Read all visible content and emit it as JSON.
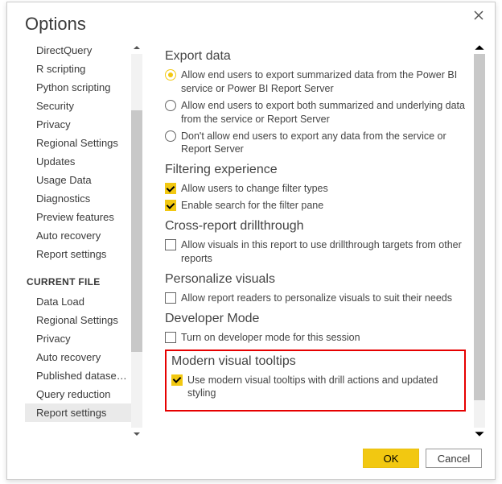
{
  "dialog": {
    "title": "Options",
    "ok": "OK",
    "cancel": "Cancel"
  },
  "nav": {
    "global": {
      "items": [
        "DirectQuery",
        "R scripting",
        "Python scripting",
        "Security",
        "Privacy",
        "Regional Settings",
        "Updates",
        "Usage Data",
        "Diagnostics",
        "Preview features",
        "Auto recovery",
        "Report settings"
      ]
    },
    "currentFile": {
      "header": "CURRENT FILE",
      "items": [
        "Data Load",
        "Regional Settings",
        "Privacy",
        "Auto recovery",
        "Published dataset set...",
        "Query reduction",
        "Report settings"
      ],
      "selectedIndex": 6
    }
  },
  "content": {
    "exportData": {
      "title": "Export data",
      "options": [
        "Allow end users to export summarized data from the Power BI service or Power BI Report Server",
        "Allow end users to export both summarized and underlying data from the service or Report Server",
        "Don't allow end users to export any data from the service or Report Server"
      ],
      "selected": 0
    },
    "filtering": {
      "title": "Filtering experience",
      "opt1": "Allow users to change filter types",
      "opt2": "Enable search for the filter pane"
    },
    "crossReport": {
      "title": "Cross-report drillthrough",
      "opt1": "Allow visuals in this report to use drillthrough targets from other reports"
    },
    "personalize": {
      "title": "Personalize visuals",
      "opt1": "Allow report readers to personalize visuals to suit their needs"
    },
    "devMode": {
      "title": "Developer Mode",
      "opt1": "Turn on developer mode for this session"
    },
    "modernTooltips": {
      "title": "Modern visual tooltips",
      "opt1": "Use modern visual tooltips with drill actions and updated styling"
    }
  }
}
